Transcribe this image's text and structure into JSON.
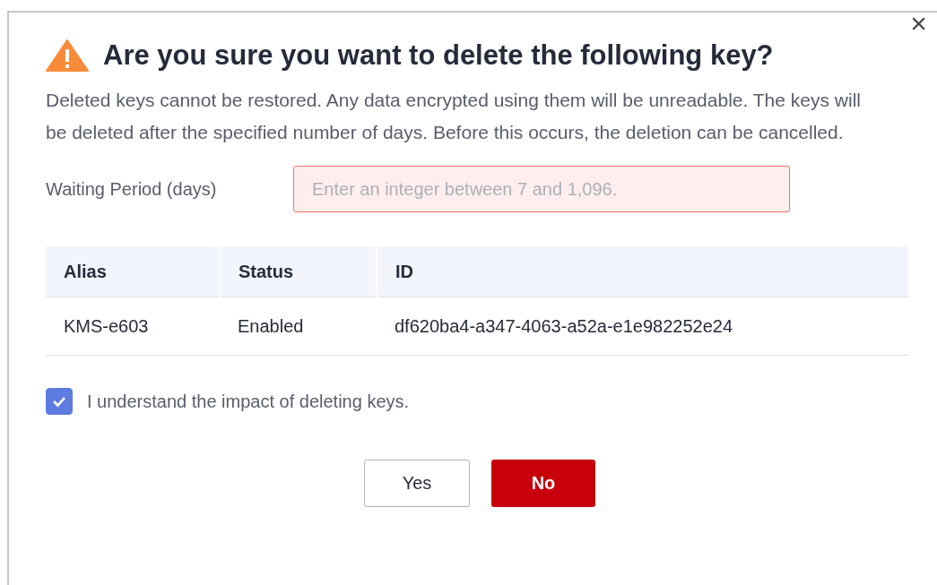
{
  "dialog": {
    "title": "Are you sure you want to delete the following key?",
    "close": "×",
    "message": "Deleted keys cannot be restored. Any data encrypted using them will be unreadable. The keys will be deleted after the specified number of days. Before this occurs, the deletion can be cancelled.",
    "waiting_period": {
      "label": "Waiting Period (days)",
      "placeholder": "Enter an integer between 7 and 1,096.",
      "error": true
    },
    "table": {
      "columns": [
        "Alias",
        "Status",
        "ID"
      ],
      "rows": [
        [
          "KMS-e603",
          "Enabled",
          "df620ba4-a347-4063-a52a-e1e982252e24"
        ]
      ]
    },
    "confirm": {
      "label": "I understand the impact of deleting keys.",
      "checked": true
    },
    "buttons": [
      {
        "label": "Yes",
        "kind": "secondary"
      },
      {
        "label": "No",
        "kind": "primary"
      }
    ]
  }
}
